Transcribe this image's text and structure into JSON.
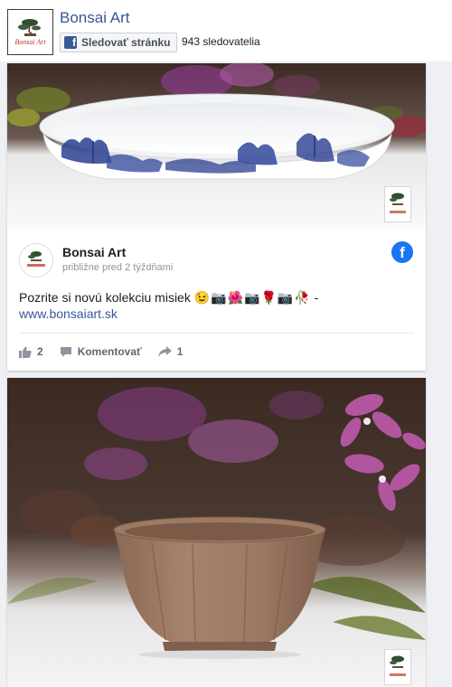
{
  "page": {
    "name": "Bonsai Art",
    "follow_label": "Sledovať stránku",
    "followers": "943 sledovatelia",
    "logo_text": "Bonsai Art"
  },
  "post1": {
    "author": "Bonsai Art",
    "time": "približne pred 2 týždňami",
    "text": "Pozrite si novú kolekciu misiek",
    "emojis": "😉📷🌺📷🌹📷🥀",
    "text_suffix": " -",
    "link": "www.bonsaiart.sk",
    "likes": "2",
    "comment_label": "Komentovať",
    "shares": "1"
  },
  "icons": {
    "facebook_square": "facebook-f-icon",
    "facebook_circle": "facebook-logo-icon",
    "like": "thumbs-up-icon",
    "comment": "comment-bubble-icon",
    "share": "share-arrow-icon"
  },
  "colors": {
    "link": "#365899",
    "facebook_blue": "#1877f2",
    "logo_red": "#c0392b"
  }
}
